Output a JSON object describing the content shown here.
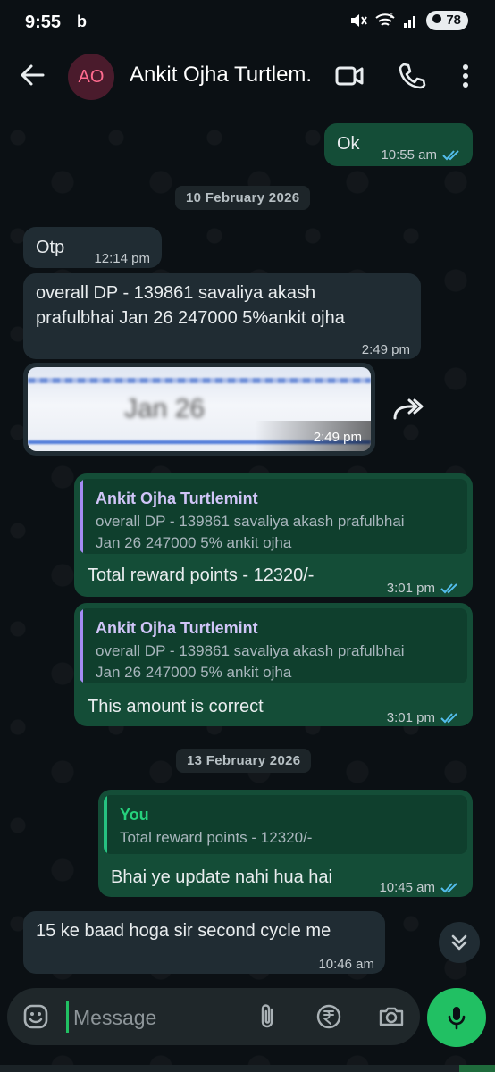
{
  "status_bar": {
    "time": "9:55",
    "carrier_glyph": "b",
    "network": "5",
    "battery": "78"
  },
  "header": {
    "avatar_initials": "AO",
    "contact_name": "Ankit Ojha Turtlem..."
  },
  "messages": {
    "m1": {
      "text": "Ok",
      "time": "10:55 am"
    },
    "date1": "10 February 2026",
    "m2": {
      "text": "Otp",
      "time": "12:14 pm"
    },
    "m3": {
      "line1": "overall DP - 139861  savaliya akash",
      "line2": "prafulbhai  Jan 26  247000 5%ankit ojha",
      "time": "2:49 pm"
    },
    "m4": {
      "image_text": "Jan 26",
      "time": "2:49 pm"
    },
    "m5": {
      "quote_name": "Ankit Ojha Turtlemint",
      "quote_line1": "overall DP - 139861 savaliya akash prafulbhai",
      "quote_line2": "Jan 26  247000 5% ankit ojha",
      "text": "Total reward points - 12320/-",
      "time": "3:01 pm"
    },
    "m6": {
      "quote_name": "Ankit Ojha Turtlemint",
      "quote_line1": "overall DP - 139861 savaliya akash prafulbhai",
      "quote_line2": "Jan 26  247000 5% ankit ojha",
      "text": "This amount is correct",
      "time": "3:01 pm"
    },
    "date2": "13 February 2026",
    "m7": {
      "quote_name": "You",
      "quote_line1": "Total reward points - 12320/-",
      "text": "Bhai ye update nahi hua hai",
      "time": "10:45 am"
    },
    "m8": {
      "text": "15 ke baad hoga sir second cycle me",
      "time": "10:46 am"
    }
  },
  "composer": {
    "placeholder": "Message"
  },
  "colors": {
    "incoming": "#202c33",
    "outgoing": "#144d37",
    "accent": "#21c063",
    "tick": "#53bdeb"
  },
  "icons": [
    "back-arrow-icon",
    "video-call-icon",
    "phone-icon",
    "more-vert-icon",
    "forward-icon",
    "double-chevron-down-icon",
    "sticker-icon",
    "attach-icon",
    "rupee-icon",
    "camera-icon",
    "mic-icon"
  ]
}
